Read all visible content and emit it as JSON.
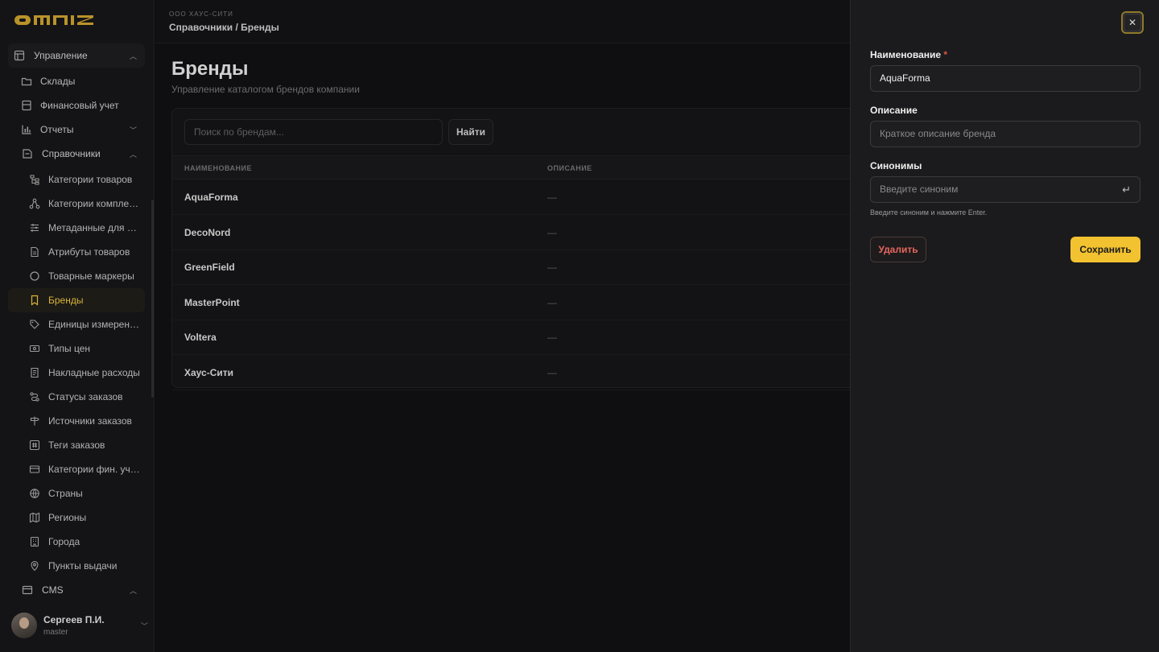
{
  "brand": {
    "logo_text": "OMNIZ",
    "accent": "#f2c230"
  },
  "sidebar": {
    "groups": [
      {
        "label": "Управление",
        "icon": "layout-icon"
      },
      {
        "label": "Справочники",
        "icon": "book-icon"
      },
      {
        "label": "CMS",
        "icon": "window-icon"
      }
    ],
    "items": [
      {
        "label": "Склады",
        "icon": "folder-icon"
      },
      {
        "label": "Финансовый учет",
        "icon": "ledger-icon"
      },
      {
        "label": "Отчеты",
        "icon": "chart-icon"
      }
    ],
    "sub_items": [
      {
        "label": "Категории товаров",
        "icon": "tree-icon"
      },
      {
        "label": "Категории комплектующих",
        "icon": "nodes-icon"
      },
      {
        "label": "Метаданные для выгрузки",
        "icon": "sliders-icon"
      },
      {
        "label": "Атрибуты товаров",
        "icon": "file-icon"
      },
      {
        "label": "Товарные маркеры",
        "icon": "circle-icon"
      },
      {
        "label": "Бренды",
        "icon": "bookmark-icon"
      },
      {
        "label": "Единицы измерения",
        "icon": "tag-icon"
      },
      {
        "label": "Типы цен",
        "icon": "banknote-icon"
      },
      {
        "label": "Накладные расходы",
        "icon": "receipt-icon"
      },
      {
        "label": "Статусы заказов",
        "icon": "route-icon"
      },
      {
        "label": "Источники заказов",
        "icon": "signpost-icon"
      },
      {
        "label": "Теги заказов",
        "icon": "hash-icon"
      },
      {
        "label": "Категории фин. учета",
        "icon": "card-icon"
      },
      {
        "label": "Страны",
        "icon": "globe-icon"
      },
      {
        "label": "Регионы",
        "icon": "map-icon"
      },
      {
        "label": "Города",
        "icon": "building-icon"
      },
      {
        "label": "Пункты выдачи",
        "icon": "pin-icon"
      }
    ],
    "user": {
      "name": "Сергеев П.И.",
      "role": "master"
    }
  },
  "header": {
    "org": "ООО ХАУС-СИТИ",
    "breadcrumb": "Справочники / Бренды"
  },
  "page": {
    "title": "Бренды",
    "subtitle": "Управление каталогом брендов компании"
  },
  "search": {
    "placeholder": "Поиск по брендам...",
    "button": "Найти"
  },
  "table": {
    "columns": [
      "НАИМЕНОВАНИЕ",
      "ОПИСАНИЕ"
    ],
    "rows": [
      {
        "name": "AquaForma",
        "desc": "—"
      },
      {
        "name": "DecoNord",
        "desc": "—"
      },
      {
        "name": "GreenField",
        "desc": "—"
      },
      {
        "name": "MasterPoint",
        "desc": "—"
      },
      {
        "name": "Voltera",
        "desc": "—"
      },
      {
        "name": "Хаус-Сити",
        "desc": "—"
      }
    ]
  },
  "drawer": {
    "close": "✕",
    "name_label": "Наименование",
    "required_mark": "*",
    "name_value": "AquaForma",
    "desc_label": "Описание",
    "desc_placeholder": "Краткое описание бренда",
    "syn_label": "Синонимы",
    "syn_placeholder": "Введите синоним",
    "enter_glyph": "↵",
    "syn_hint": "Введите синоним и нажмите Enter.",
    "delete": "Удалить",
    "save": "Сохранить"
  }
}
